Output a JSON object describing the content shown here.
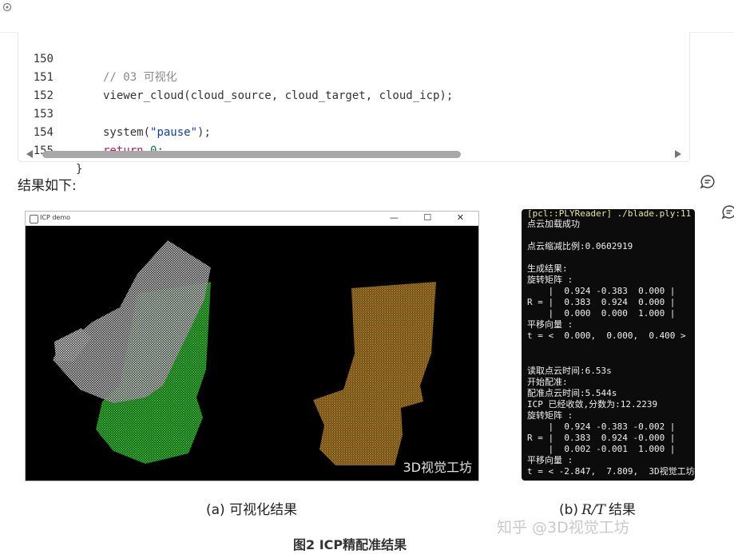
{
  "code": {
    "lines": [
      {
        "no": "150",
        "text": "// 03 可视化"
      },
      {
        "no": "151",
        "text": "viewer_cloud(cloud_source, cloud_target, cloud_icp);"
      },
      {
        "no": "152",
        "text": ""
      },
      {
        "no": "153",
        "pre": "system(",
        "str": "\"pause\"",
        "post": ");"
      },
      {
        "no": "154",
        "kw": "return",
        "num": "0",
        "post": ";"
      },
      {
        "no": "155",
        "text": "}"
      }
    ]
  },
  "result_title": "结果如下:",
  "viewer": {
    "title": "ICP demo",
    "buttons": "— ☐ ✕",
    "watermark": "3D视觉工坊"
  },
  "terminal": {
    "lines": [
      "[pcl::PLYReader] ./blade.ply:11",
      "点云加载成功",
      "",
      "点云缩减比例:0.0602919",
      "",
      "生成结果:",
      "旋转矩阵 :",
      "    |  0.924 -0.383  0.000 |",
      "R = |  0.383  0.924  0.000 |",
      "    |  0.000  0.000  1.000 |",
      "平移向量 :",
      "t = <  0.000,  0.000,  0.400 >",
      "",
      "",
      "读取点云时间:6.53s",
      "开始配准:",
      "配准点云时间:5.544s",
      "ICP 已经收敛,分数为:12.2239",
      "旋转矩阵 :",
      "    |  0.924 -0.383 -0.002 |",
      "R = |  0.383  0.924 -0.000 |",
      "    |  0.002 -0.001  1.000 |",
      "平移向量 :",
      "t = < -2.847,  7.809,  3D视觉工坊"
    ]
  },
  "captions": {
    "a": "(a) 可视化结果",
    "b_prefix": "(b)",
    "b_math": "R/T",
    "b_suffix": "结果"
  },
  "figure_caption": "图2 ICP精配准结果",
  "platform_watermark": "知乎 @3D视觉工坊",
  "colors": {
    "source_cloud": "#ffffff",
    "target_cloud": "#35c435",
    "icp_cloud": "#c96a1e"
  }
}
